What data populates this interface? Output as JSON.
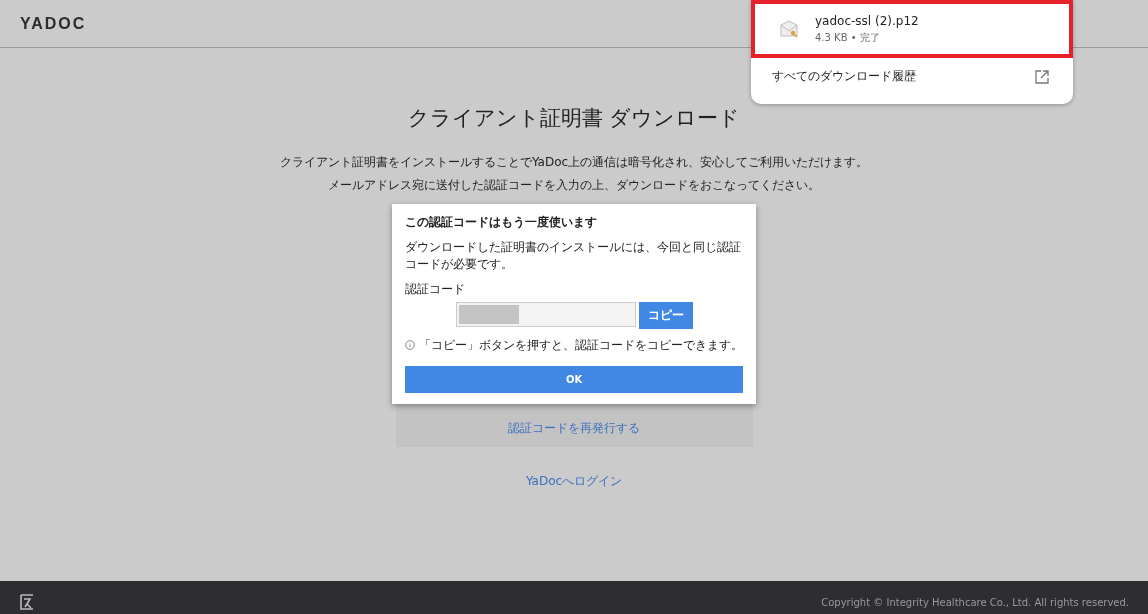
{
  "header": {
    "logo": "YADOC"
  },
  "page": {
    "title": "クライアント証明書 ダウンロード",
    "description": [
      "クライアント証明書をインストールすることでYaDoc上の通信は暗号化され、安心してご利用いただけます。",
      "メールアドレス宛に送付した認証コードを入力の上、ダウンロードをおこなってください。"
    ],
    "reissue_link": "認証コードを再発行する",
    "login_link": "YaDocへログイン"
  },
  "dialog": {
    "title": "この認証コードはもう一度使います",
    "message": "ダウンロードした証明書のインストールには、今回と同じ認証コードが必要です。",
    "code_label": "認証コード",
    "copy_button": "コピー",
    "hint": "「コピー」ボタンを押すと、認証コードをコピーできます。",
    "ok_button": "OK"
  },
  "downloads": {
    "items": [
      {
        "filename": "yadoc-ssl (2).p12",
        "meta": "4.3 KB • 完了",
        "highlighted": true
      }
    ],
    "history_link": "すべてのダウンロード履歴"
  },
  "footer": {
    "copyright": "Copyright © Integrity Healthcare Co., Ltd. All rights reserved."
  }
}
